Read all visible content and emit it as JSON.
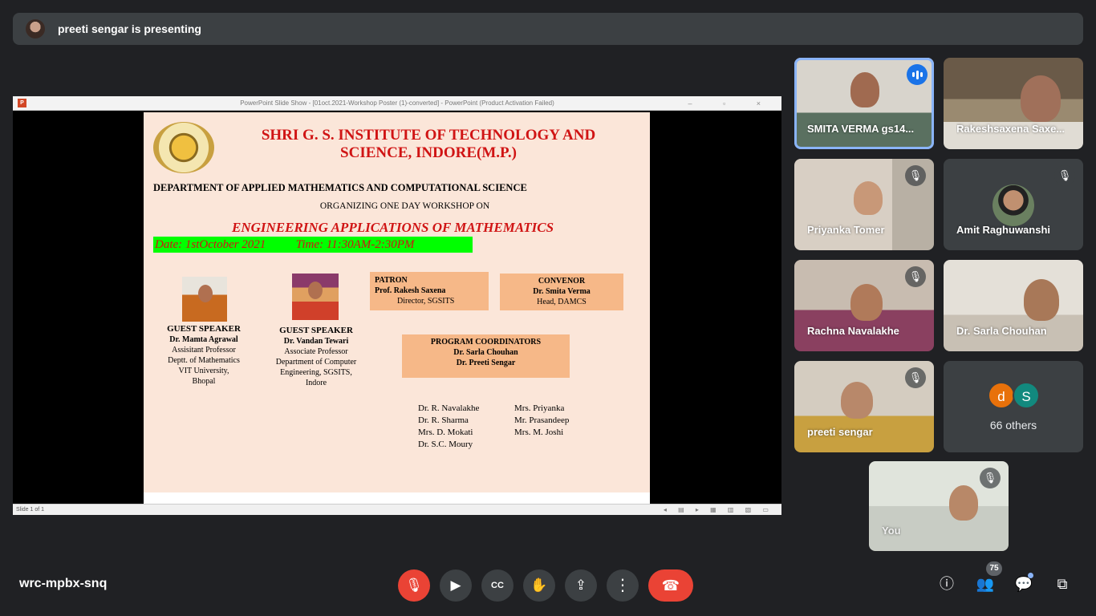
{
  "presenter": {
    "text": "preeti sengar is presenting"
  },
  "window": {
    "title": "PowerPoint Slide Show - [01oct.2021-Workshop Poster (1)-converted] - PowerPoint (Product Activation Failed)",
    "status": "Slide 1 of 1"
  },
  "slide": {
    "institute": "SHRI G. S. INSTITUTE OF TECHNOLOGY AND SCIENCE, INDORE(M.P.)",
    "department": "DEPARTMENT OF APPLIED MATHEMATICS AND COMPUTATIONAL  SCIENCE",
    "organizing": "ORGANIZING ONE DAY WORKSHOP ON",
    "workshop": "ENGINEERING APPLICATIONS OF MATHEMATICS",
    "date_time": "Date: 1stOctober 2021          Time: 11:30AM-2:30PM",
    "speaker1": {
      "role": "GUEST SPEAKER",
      "name": "Dr. Mamta Agrawal",
      "title": "Assisitant Professor",
      "dept": "Deptt. of Mathematics",
      "org": "VIT University,",
      "city": "Bhopal"
    },
    "speaker2": {
      "role": "GUEST SPEAKER",
      "name": "Dr. Vandan Tewari",
      "title": "Associate Professor",
      "dept": "Department of Computer",
      "org": "Engineering, SGSITS,",
      "city": "Indore"
    },
    "patron": {
      "heading": "PATRON",
      "name": "Prof. Rakesh Saxena",
      "title": "Director, SGSITS"
    },
    "convenor": {
      "heading": "CONVENOR",
      "name": "Dr. Smita Verma",
      "title": "Head, DAMCS"
    },
    "coordinators": {
      "heading": "PROGRAM COORDINATORS",
      "name1": "Dr. Sarla Chouhan",
      "name2": "Dr. Preeti Sengar"
    },
    "members_left": [
      "Dr. R. Navalakhe",
      "Dr. R. Sharma",
      "Mrs. D. Mokati",
      "Dr. S.C.  Moury"
    ],
    "members_right": [
      "Mrs. Priyanka",
      "Mr. Prasandeep",
      "Mrs. M. Joshi"
    ]
  },
  "participants": [
    {
      "name": "SMITA VERMA gs14...",
      "state": "speaking"
    },
    {
      "name": "Rakeshsaxena Saxe...",
      "state": "none"
    },
    {
      "name": "Priyanka Tomer",
      "state": "muted"
    },
    {
      "name": "Amit Raghuwanshi",
      "state": "muted"
    },
    {
      "name": "Rachna Navalakhe",
      "state": "muted"
    },
    {
      "name": "Dr. Sarla Chouhan",
      "state": "none"
    },
    {
      "name": "preeti sengar",
      "state": "muted"
    }
  ],
  "others": {
    "avatar1": "d",
    "avatar2": "S",
    "label": "66 others",
    "avatar1_color": "#e8710a",
    "avatar2_color": "#12897e"
  },
  "self": {
    "label": "You"
  },
  "meeting": {
    "code": "wrc-mpbx-snq",
    "participant_count": "75"
  },
  "colors": {
    "background": "#202124",
    "end_call": "#ea4335",
    "accent": "#8ab4f8"
  }
}
